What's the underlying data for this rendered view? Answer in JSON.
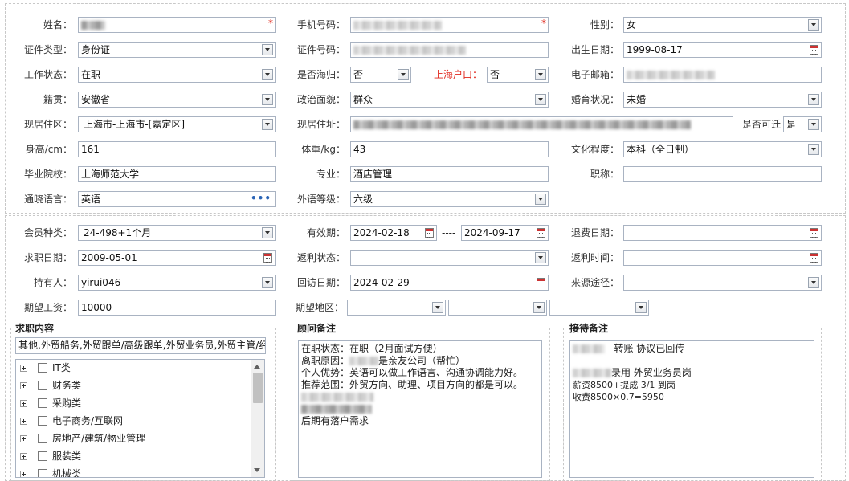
{
  "colors": {
    "required_star": "#e0261b",
    "label_red": "#e0261b",
    "border": "#a9b3c2"
  },
  "required_mark": "*",
  "range_separator": "----",
  "fields": {
    "name": {
      "label": "姓名："
    },
    "phone": {
      "label": "手机号码："
    },
    "gender": {
      "label": "性别：",
      "value": "女"
    },
    "id_type": {
      "label": "证件类型：",
      "value": "身份证"
    },
    "id_no": {
      "label": "证件号码："
    },
    "birth": {
      "label": "出生日期：",
      "value": "1999-08-17"
    },
    "work_status": {
      "label": "工作状态：",
      "value": "在职"
    },
    "overseas": {
      "label": "是否海归：",
      "value": "否"
    },
    "sh_hukou": {
      "label": "上海户口：",
      "value": "否"
    },
    "email": {
      "label": "电子邮箱："
    },
    "native": {
      "label": "籍贯：",
      "value": "安徽省"
    },
    "political": {
      "label": "政治面貌：",
      "value": "群众"
    },
    "marital": {
      "label": "婚育状况：",
      "value": "未婚"
    },
    "region": {
      "label": "现居住区：",
      "value": "上海市-上海市-[嘉定区]"
    },
    "address": {
      "label": "现居住址："
    },
    "relocate": {
      "label": "是否可迁",
      "value": "是"
    },
    "height": {
      "label": "身高/cm：",
      "value": "161"
    },
    "weight": {
      "label": "体重/kg：",
      "value": "43"
    },
    "education": {
      "label": "文化程度：",
      "value": "本科（全日制）"
    },
    "school": {
      "label": "毕业院校：",
      "value": "上海师范大学"
    },
    "major": {
      "label": "专业：",
      "value": "酒店管理"
    },
    "title": {
      "label": "职称：",
      "value": ""
    },
    "language": {
      "label": "通晓语言：",
      "value": "英语"
    },
    "lang_level": {
      "label": "外语等级：",
      "value": "六级"
    },
    "member_type": {
      "label": "会员种类：",
      "value": "24-498+1个月"
    },
    "validity": {
      "label": "有效期：",
      "start": "2024-02-18",
      "end": "2024-09-17"
    },
    "refund_date": {
      "label": "退费日期：",
      "value": ""
    },
    "job_date": {
      "label": "求职日期：",
      "value": "2009-05-01"
    },
    "rebate_status": {
      "label": "返利状态：",
      "value": ""
    },
    "rebate_time": {
      "label": "返利时间：",
      "value": ""
    },
    "holder": {
      "label": "持有人：",
      "value": "yirui046"
    },
    "visit_date": {
      "label": "回访日期：",
      "value": "2024-02-29"
    },
    "source": {
      "label": "来源途径：",
      "value": ""
    },
    "salary": {
      "label": "期望工资：",
      "value": "10000"
    },
    "expect_area": {
      "label": "期望地区："
    }
  },
  "job_content": {
    "title": "求职内容",
    "summary": "其他,外贸船务,外贸跟单/高级跟单,外贸业务员,外贸主管/经",
    "categories": [
      "IT类",
      "财务类",
      "采购类",
      "电子商务/互联网",
      "房地产/建筑/物业管理",
      "服装类",
      "机械类"
    ]
  },
  "consultant_notes": {
    "title": "顾问备注",
    "lines": [
      "在职状态：在职（2月面试方便）",
      "离职原因：",
      "是亲友公司（帮忙）",
      "个人优势：英语可以做工作语言、沟通协调能力好。",
      "推荐范围：外贸方向、助理、项目方向的都是可以。",
      "后期有落户需求"
    ]
  },
  "reception_notes": {
    "title": "接待备注",
    "lines": [
      "转账 协议已回传",
      "录用  外贸业务员岗",
      "薪资8500+提成  3/1 到岗",
      "收费8500×0.7=5950"
    ]
  }
}
